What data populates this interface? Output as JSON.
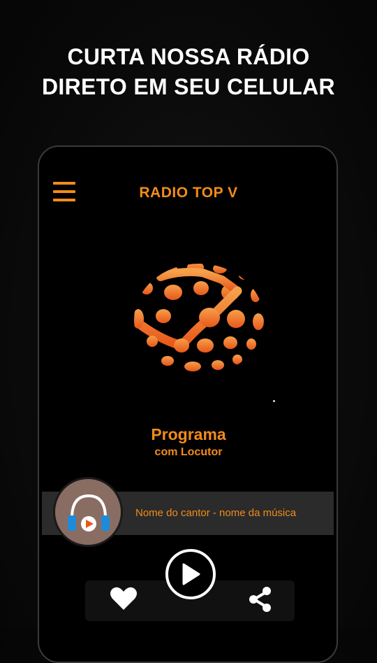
{
  "promo": {
    "line1": "CURTA NOSSA RÁDIO",
    "line2": "DIRETO EM SEU CELULAR"
  },
  "app": {
    "title": "RADIO TOP V",
    "menu_icon": "hamburger-menu-icon",
    "logo_icon": "globe-dots-logo",
    "accent_color": "#f28c1a"
  },
  "program": {
    "title": "Programa",
    "subtitle": "com Locutor"
  },
  "now_playing": {
    "text": "Nome do cantor - nome da música",
    "avatar_icon": "headphones-play-icon"
  },
  "controls": {
    "play_icon": "play-icon",
    "like_icon": "heart-icon",
    "share_icon": "share-icon"
  }
}
